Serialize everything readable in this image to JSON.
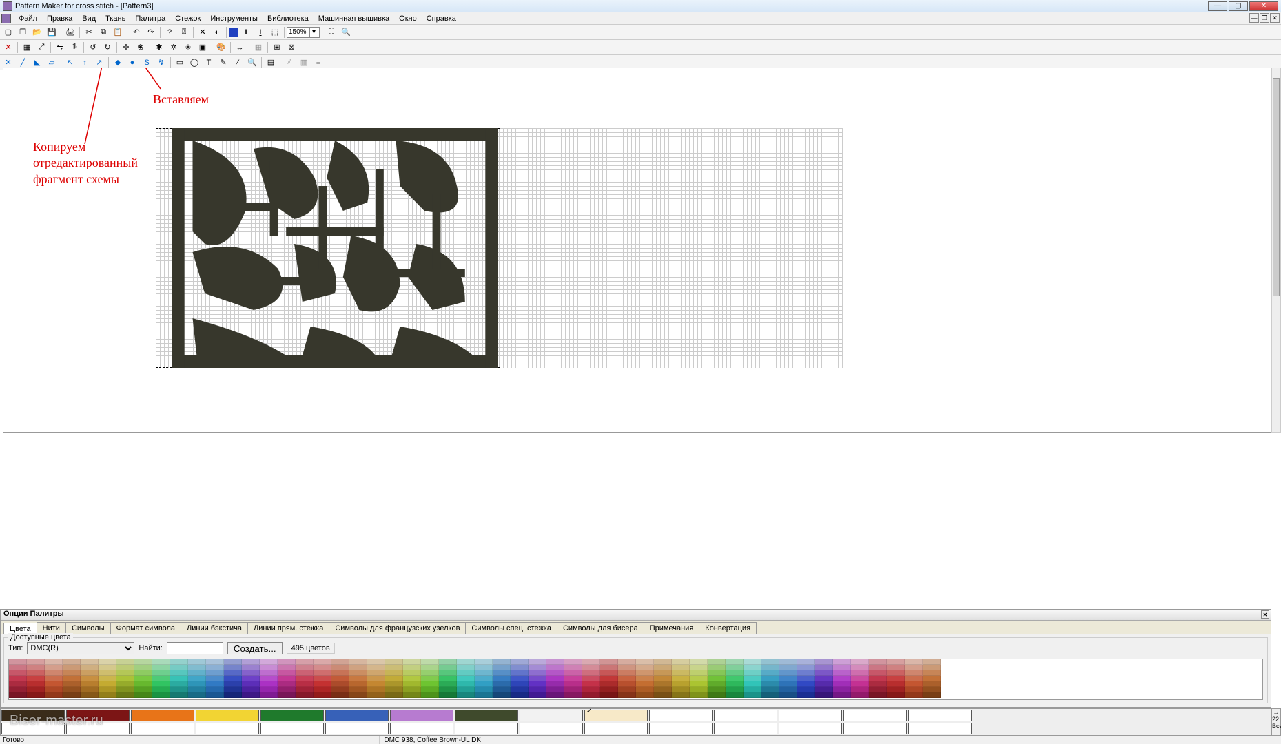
{
  "title": "Pattern Maker for cross stitch - [Pattern3]",
  "menu": [
    "Файл",
    "Правка",
    "Вид",
    "Ткань",
    "Палитра",
    "Стежок",
    "Инструменты",
    "Библиотека",
    "Машинная вышивка",
    "Окно",
    "Справка"
  ],
  "zoom": "150%",
  "annotations": {
    "copy": "Копируем отредактированный фрагмент схемы",
    "paste": "Вставляем"
  },
  "palette": {
    "title": "Опции Палитры",
    "tabs": [
      "Цвета",
      "Нити",
      "Символы",
      "Формат символа",
      "Линии бэкстича",
      "Линии прям. стежка",
      "Символы для французских узелков",
      "Символы спец. стежка",
      "Символы для бисера",
      "Примечания",
      "Конвертация"
    ],
    "group_label": "Доступные цвета",
    "type_label": "Тип:",
    "type_value": "DMC(R)",
    "find_label": "Найти:",
    "create_label": "Создать...",
    "count_label": "495 цветов"
  },
  "watermark": "Biser-master.ru",
  "status_left": "Готово",
  "status_right": "DMC  938, Coffee Brown-UL DK",
  "side_count": "22",
  "side_all": "Все",
  "bottom_palette_colors": [
    "#3a2c1a",
    "#7c1515",
    "#e87418",
    "#f2d433",
    "#1f7a2c",
    "#3761b8",
    "#b77bd0",
    "#3f4a2c",
    "#f2f2f2",
    "#f7e9c8",
    "",
    "",
    "",
    "",
    ""
  ]
}
